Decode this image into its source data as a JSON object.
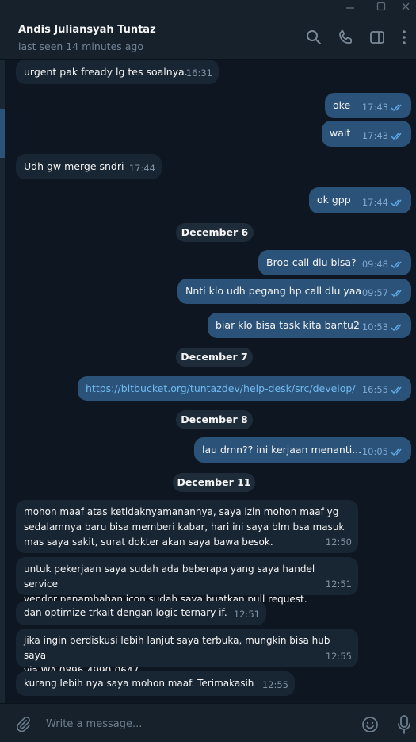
{
  "header": {
    "name": "Andis Juliansyah Tuntaz",
    "status": "last seen 14 minutes ago"
  },
  "icons": {
    "titlebar": [
      "minimize-icon",
      "maximize-icon",
      "close-icon"
    ],
    "header": [
      "search-icon",
      "phone-icon",
      "sidebar-toggle-icon",
      "more-icon"
    ],
    "composer": [
      "attach-icon",
      "emoji-icon",
      "microphone-icon"
    ]
  },
  "messages": [
    {
      "dir": "in",
      "text": "urgent pak fready lg tes soalnya.",
      "time": "16:31"
    },
    {
      "dir": "out",
      "text": "oke",
      "time": "17:43"
    },
    {
      "dir": "out",
      "text": "wait",
      "time": "17:43"
    },
    {
      "dir": "in",
      "text": "Udh gw merge sndri",
      "time": "17:44"
    },
    {
      "dir": "out",
      "text": "ok gpp",
      "time": "17:44"
    },
    {
      "dir": "out",
      "text": "Broo call dlu bisa?",
      "time": "09:48"
    },
    {
      "dir": "out",
      "text": "Nnti klo udh pegang hp call dlu yaa",
      "time": "09:57"
    },
    {
      "dir": "out",
      "text": "biar klo bisa task kita bantu2",
      "time": "10:53"
    },
    {
      "dir": "out",
      "text": "https://bitbucket.org/tuntazdev/help-desk/src/develop/",
      "time": "16:55"
    },
    {
      "dir": "out",
      "text": "lau dmn?? ini kerjaan menanti...",
      "time": "10:05"
    },
    {
      "dir": "in",
      "text": "mohon maaf atas ketidaknyamanannya, saya izin mohon maaf yg\nsedalamnya baru bisa memberi kabar, hari ini saya blm bsa masuk\nmas saya sakit, surat dokter akan saya bawa besok.",
      "time": "12:50"
    },
    {
      "dir": "in",
      "text": "untuk pekerjaan saya sudah ada beberapa yang saya handel service\nvendor penambahan icon sudah saya buatkan pull request.",
      "time": "12:51"
    },
    {
      "dir": "in",
      "text": "dan optimize trkait dengan logic ternary if.",
      "time": "12:51"
    },
    {
      "dir": "in",
      "text": "jika ingin berdiskusi lebih lanjut saya terbuka, mungkin bisa hub saya\nvia WA 0896-4990-0647",
      "time": "12:55"
    },
    {
      "dir": "in",
      "text": "kurang lebih nya saya mohon maaf. Terimakasih",
      "time": "12:55"
    }
  ],
  "dates": [
    "December 6",
    "December 7",
    "December 8",
    "December 11"
  ],
  "composer": {
    "placeholder": "Write a message..."
  },
  "colors": {
    "background": "#0e1621",
    "header": "#17212b",
    "incoming_bubble": "#182533",
    "outgoing_bubble": "#2b5278",
    "link": "#71baf1",
    "read_check": "#5fa8e4"
  }
}
